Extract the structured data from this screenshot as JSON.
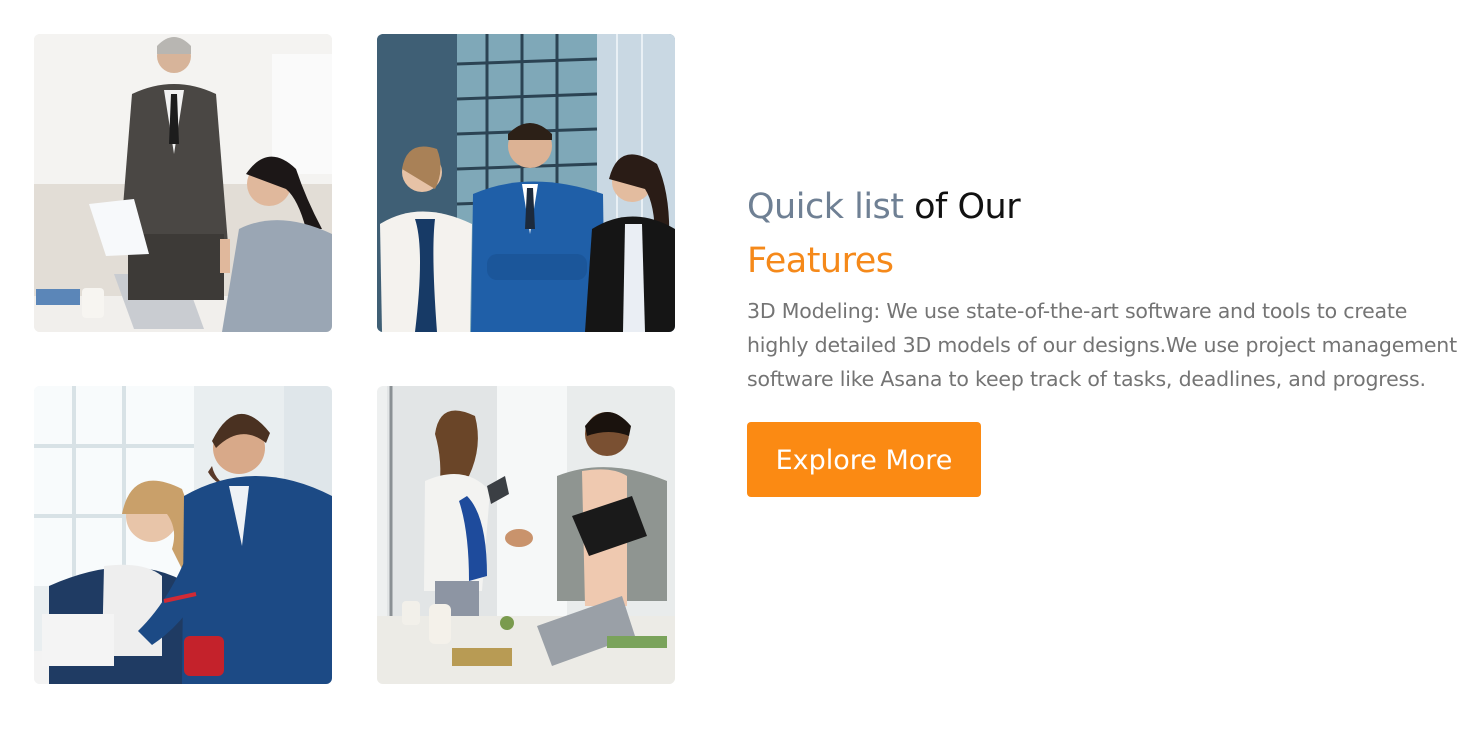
{
  "features": {
    "heading_part1": "Quick list",
    "heading_part2": "of Our",
    "heading_part3": "Features",
    "description": "3D Modeling: We use state-of-the-art software and tools to create highly detailed 3D models of our designs.We use project management software like Asana to keep track of tasks, deadlines, and progress.",
    "button_label": "Explore More"
  },
  "colors": {
    "accent": "#fb8a13",
    "muted_heading": "#6f8094",
    "body_text": "#747474"
  },
  "images": [
    {
      "name": "office-meeting-photo"
    },
    {
      "name": "business-team-photo"
    },
    {
      "name": "colleagues-laptop-photo"
    },
    {
      "name": "handshake-photo"
    }
  ]
}
